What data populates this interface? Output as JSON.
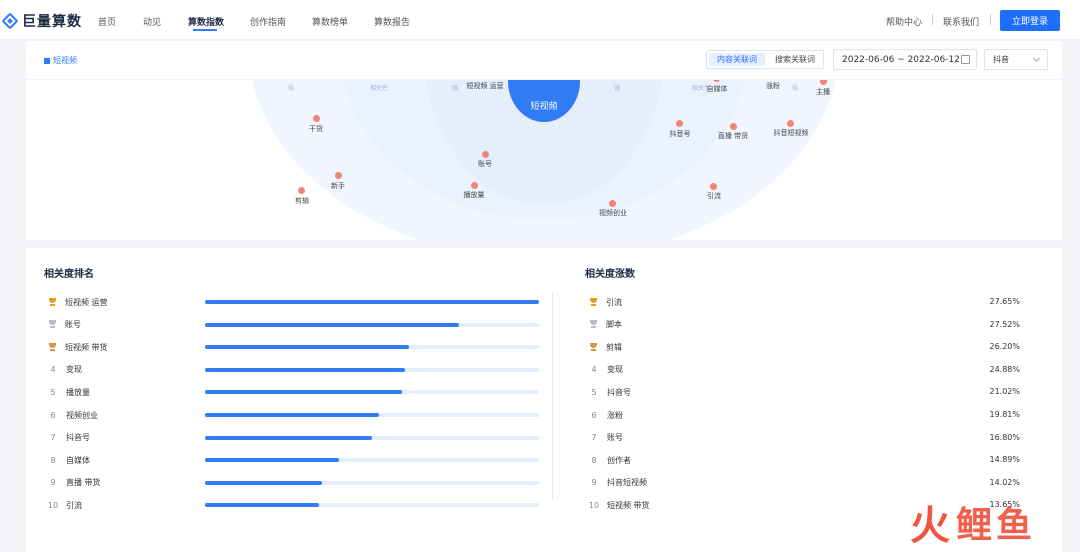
{
  "brand": {
    "name": "巨量算数"
  },
  "nav": {
    "items": [
      "首页",
      "动见",
      "算数指数",
      "创作指南",
      "算数榜单",
      "算数报告"
    ],
    "active": "算数指数"
  },
  "nav_right": {
    "help": "帮助中心",
    "contact": "联系我们",
    "login": "立即登录"
  },
  "filter": {
    "channel": "短视频",
    "seg": [
      "内容关联词",
      "搜索关联词"
    ],
    "seg_active": "内容关联词",
    "date_range": "2022-06-06 ~ 2022-06-12",
    "platform": "抖音"
  },
  "graph": {
    "center": "短视频",
    "axis_labels": [
      "弱",
      "相关性",
      "强",
      "强",
      "相关性",
      "弱"
    ],
    "nodes": [
      "短视频 运营",
      "自媒体",
      "涨粉",
      "主播",
      "干货",
      "抖音号",
      "直播 带货",
      "抖音短视频",
      "账号",
      "新手",
      "剪辑",
      "播放量",
      "引流",
      "视频创业"
    ]
  },
  "ranking": {
    "title": "相关度排名",
    "items": [
      {
        "rank": "1",
        "label": "短视频 运营",
        "value": 100
      },
      {
        "rank": "2",
        "label": "账号",
        "value": 76
      },
      {
        "rank": "3",
        "label": "短视频 带货",
        "value": 61
      },
      {
        "rank": "4",
        "label": "变现",
        "value": 60
      },
      {
        "rank": "5",
        "label": "播放量",
        "value": 59
      },
      {
        "rank": "6",
        "label": "视频创业",
        "value": 52
      },
      {
        "rank": "7",
        "label": "抖音号",
        "value": 50
      },
      {
        "rank": "8",
        "label": "自媒体",
        "value": 40
      },
      {
        "rank": "9",
        "label": "直播 带货",
        "value": 35
      },
      {
        "rank": "10",
        "label": "引流",
        "value": 34
      }
    ]
  },
  "growth": {
    "title": "相关度涨数",
    "items": [
      {
        "rank": "1",
        "label": "引流",
        "pct": "27.65%"
      },
      {
        "rank": "2",
        "label": "脚本",
        "pct": "27.52%"
      },
      {
        "rank": "3",
        "label": "剪辑",
        "pct": "26.20%"
      },
      {
        "rank": "4",
        "label": "变现",
        "pct": "24.88%"
      },
      {
        "rank": "5",
        "label": "抖音号",
        "pct": "21.02%"
      },
      {
        "rank": "6",
        "label": "涨粉",
        "pct": "19.81%"
      },
      {
        "rank": "7",
        "label": "账号",
        "pct": "16.80%"
      },
      {
        "rank": "8",
        "label": "创作者",
        "pct": "14.89%"
      },
      {
        "rank": "9",
        "label": "抖音短视频",
        "pct": "14.02%"
      },
      {
        "rank": "10",
        "label": "短视频 带货",
        "pct": "13.65%"
      }
    ]
  },
  "colors": {
    "accent": "#2f7cf6",
    "login": "#1f6fff",
    "node": "#f3837a",
    "gold": "#e0a020",
    "silver": "#b8bcc6",
    "bronze": "#d49a3c"
  },
  "watermark": {
    "fire": "火",
    "text": "鲤鱼"
  }
}
